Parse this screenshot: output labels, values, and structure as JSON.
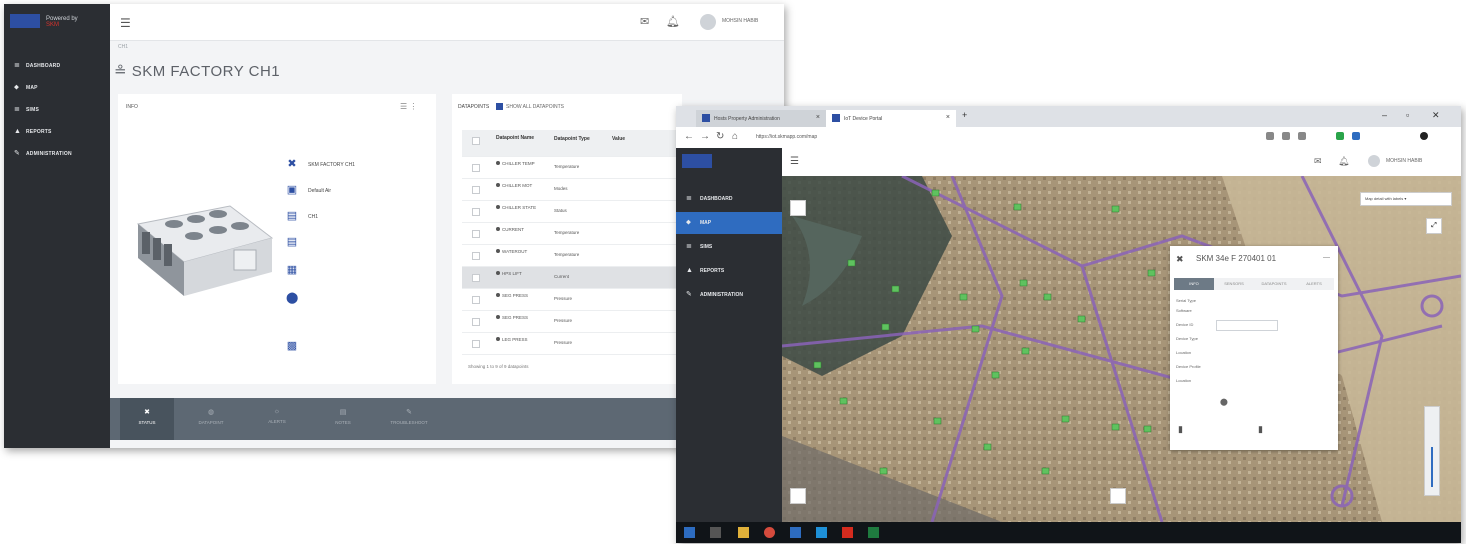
{
  "left_screen": {
    "brand": {
      "top": "SKM",
      "bottom": "Powered by"
    },
    "sidebar": [
      {
        "icon": "≣",
        "label": "DASHBOARD"
      },
      {
        "icon": "⬥",
        "label": "MAP"
      },
      {
        "icon": "≣",
        "label": "SIMS"
      },
      {
        "icon": "▲",
        "label": "REPORTS"
      },
      {
        "icon": "✎",
        "label": "ADMINISTRATION"
      }
    ],
    "user_name": "MOHSIN HABIB",
    "breadcrumb": "CH1",
    "page_title": "SKM FACTORY CH1",
    "info_card": {
      "header": "INFO",
      "rows": [
        {
          "icon": "✖",
          "key": "",
          "value": "SKM FACTORY CH1"
        },
        {
          "icon": "▣",
          "key": "",
          "value": "Default Air"
        },
        {
          "icon": "▤",
          "key": "",
          "value": "CH1"
        },
        {
          "icon": "▤",
          "key": "",
          "value": ""
        },
        {
          "icon": "▦",
          "key": "",
          "value": ""
        },
        {
          "icon": "⬤",
          "key": "",
          "value": ""
        },
        {
          "icon": "▩",
          "key": "",
          "value": ""
        }
      ]
    },
    "datapoints": {
      "title": "DATAPOINTS",
      "toggle_label": "SHOW ALL DATAPOINTS",
      "headers": [
        "Datapoint Name",
        "Datapoint Type",
        "Value"
      ],
      "rows": [
        {
          "name": "CHILLER TEMP",
          "type": "Temperature",
          "value": ""
        },
        {
          "name": "CHILLER MOT",
          "type": "Modes",
          "value": ""
        },
        {
          "name": "CHILLER STATE",
          "type": "Status",
          "value": ""
        },
        {
          "name": "CURRENT",
          "type": "Temperature",
          "value": ""
        },
        {
          "name": "WATEROUT",
          "type": "Temperature",
          "value": ""
        },
        {
          "name": "HPS LIFT",
          "type": "Current",
          "value": ""
        },
        {
          "name": "SEG PRESS",
          "type": "Pressure",
          "value": ""
        },
        {
          "name": "SEG PRESS",
          "type": "Pressure",
          "value": ""
        },
        {
          "name": "LEG PRESS",
          "type": "Pressure",
          "value": ""
        }
      ],
      "footer": "Showing 1 to 9 of 9 datapoints"
    },
    "bottom_tabs": [
      {
        "icon": "✖",
        "label": "STATUS"
      },
      {
        "icon": "◍",
        "label": "DATAPOINT"
      },
      {
        "icon": "☼",
        "label": "ALERTS"
      },
      {
        "icon": "▤",
        "label": "NOTES"
      },
      {
        "icon": "✎",
        "label": "TROUBLESHOOT"
      }
    ]
  },
  "right_screen": {
    "tabs": [
      {
        "title": "Hosts Property Administration",
        "close": "×"
      },
      {
        "title": "IoT Device Portal",
        "close": "×"
      }
    ],
    "url": "https://iot.skmapp.com/map",
    "sidebar": [
      {
        "icon": "≣",
        "label": "DASHBOARD",
        "active": false
      },
      {
        "icon": "⬥",
        "label": "MAP",
        "active": true
      },
      {
        "icon": "≣",
        "label": "SIMS",
        "active": false
      },
      {
        "icon": "▲",
        "label": "REPORTS",
        "active": false
      },
      {
        "icon": "✎",
        "label": "ADMINISTRATION",
        "active": false
      }
    ],
    "user_name": "MOHSIN HABIB",
    "map_layer": "Map detail with labels",
    "popup": {
      "title": "SKM 34e F 270401 01",
      "subtitle": "",
      "tabs": [
        "INFO",
        "SENSORS",
        "DATAPOINTS",
        "ALERTS"
      ],
      "rows": [
        {
          "key": "Serial Type",
          "value": ""
        },
        {
          "key": "Software",
          "value": ""
        },
        {
          "key": "Device ID",
          "value": ""
        },
        {
          "key": "Device Type",
          "value": ""
        },
        {
          "key": "Location",
          "value": ""
        },
        {
          "key": "Device Profile",
          "value": ""
        },
        {
          "key": "Location",
          "value": ""
        }
      ],
      "sensors": [
        {
          "key": "",
          "value": ""
        },
        {
          "key": "",
          "value": ""
        }
      ]
    },
    "taskbar_time": "",
    "taskbar_date": ""
  },
  "colors": {
    "sidebar": "#2b2e33",
    "accent": "#2d4fa3",
    "active_nav": "#2f6cc0",
    "value_green": "#3aa84a",
    "bottom_bar": "#5d6873",
    "map_base": "#b5a48a",
    "map_roads": "#8a63b8"
  }
}
